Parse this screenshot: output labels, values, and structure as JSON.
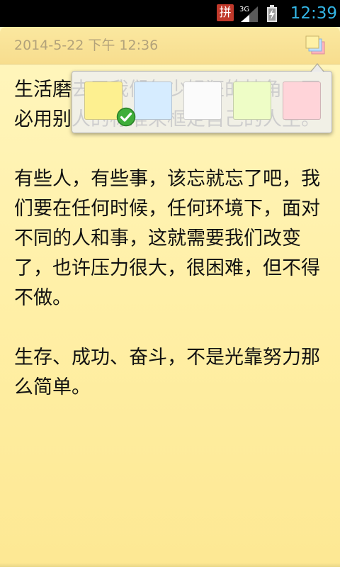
{
  "status_bar": {
    "ime_label": "拼",
    "network_label": "3G",
    "time": "12:39",
    "time_color": "#33b5e5"
  },
  "note": {
    "date": "2014-5-22 下午 12:36",
    "paragraphs": [
      "生活磨去了我们年少轻狂的棱角，不必用别人的标准来框定自己的人生。",
      "有些人，有些事，该忘就忘了吧，我们要在任何时候，任何环境下，面对不同的人和事，这就需要我们改变了，也许压力很大，很困难，但不得不做。",
      "生存、成功、奋斗，不是光靠努力那么简单。"
    ]
  },
  "color_picker": {
    "selected": "yellow",
    "swatches": [
      {
        "name": "yellow",
        "color": "#fdf090"
      },
      {
        "name": "blue",
        "color": "#d6ecff"
      },
      {
        "name": "white",
        "color": "#fbfbfb"
      },
      {
        "name": "green",
        "color": "#eefdc6"
      },
      {
        "name": "red",
        "color": "#ffd4d9"
      }
    ]
  },
  "icons": {
    "ime": "ime-pinyin-icon",
    "signal": "signal-3g-icon",
    "battery": "battery-charging-icon",
    "bg_color": "bg-color-icon",
    "check": "check-icon"
  }
}
